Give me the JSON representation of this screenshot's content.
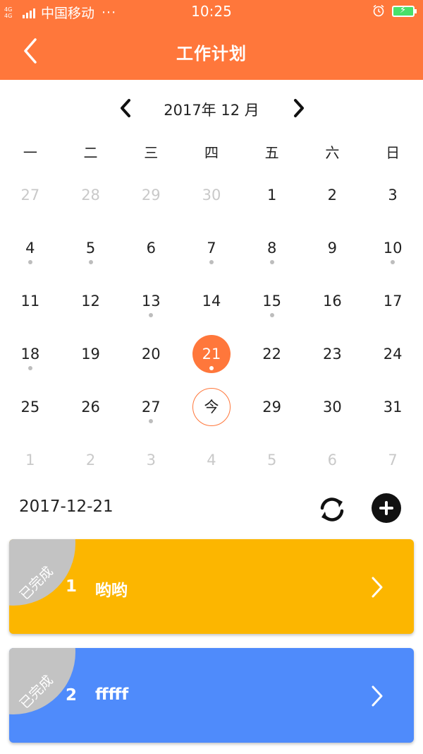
{
  "status_bar": {
    "network_type": "4G 4G",
    "carrier": "中国移动",
    "more": "···",
    "time": "10:25"
  },
  "header": {
    "title": "工作计划",
    "accent_color": "#ff773b"
  },
  "calendar": {
    "month_label": "2017年 12 月",
    "weekdays": [
      "一",
      "二",
      "三",
      "四",
      "五",
      "六",
      "日"
    ],
    "weeks": [
      [
        {
          "d": "27",
          "other": true
        },
        {
          "d": "28",
          "other": true
        },
        {
          "d": "29",
          "other": true
        },
        {
          "d": "30",
          "other": true
        },
        {
          "d": "1"
        },
        {
          "d": "2"
        },
        {
          "d": "3"
        }
      ],
      [
        {
          "d": "4",
          "dot": true
        },
        {
          "d": "5",
          "dot": true
        },
        {
          "d": "6"
        },
        {
          "d": "7",
          "dot": true
        },
        {
          "d": "8",
          "dot": true
        },
        {
          "d": "9"
        },
        {
          "d": "10",
          "dot": true
        }
      ],
      [
        {
          "d": "11"
        },
        {
          "d": "12"
        },
        {
          "d": "13",
          "dot": true
        },
        {
          "d": "14"
        },
        {
          "d": "15",
          "dot": true
        },
        {
          "d": "16"
        },
        {
          "d": "17"
        }
      ],
      [
        {
          "d": "18",
          "dot": true
        },
        {
          "d": "19"
        },
        {
          "d": "20"
        },
        {
          "d": "21",
          "dot": true,
          "selected": true
        },
        {
          "d": "22"
        },
        {
          "d": "23"
        },
        {
          "d": "24"
        }
      ],
      [
        {
          "d": "25"
        },
        {
          "d": "26"
        },
        {
          "d": "27",
          "dot": true
        },
        {
          "d": "今",
          "today": true
        },
        {
          "d": "29"
        },
        {
          "d": "30"
        },
        {
          "d": "31"
        }
      ],
      [
        {
          "d": "1",
          "other": true
        },
        {
          "d": "2",
          "other": true
        },
        {
          "d": "3",
          "other": true
        },
        {
          "d": "4",
          "other": true
        },
        {
          "d": "5",
          "other": true
        },
        {
          "d": "6",
          "other": true
        },
        {
          "d": "7",
          "other": true
        }
      ]
    ]
  },
  "selected_date": "2017-12-21",
  "tasks": [
    {
      "index": "1",
      "name": "哟哟",
      "status": "已完成",
      "color": "#fcb600"
    },
    {
      "index": "2",
      "name": "fffff",
      "status": "已完成",
      "color": "#4f8bfb"
    }
  ]
}
